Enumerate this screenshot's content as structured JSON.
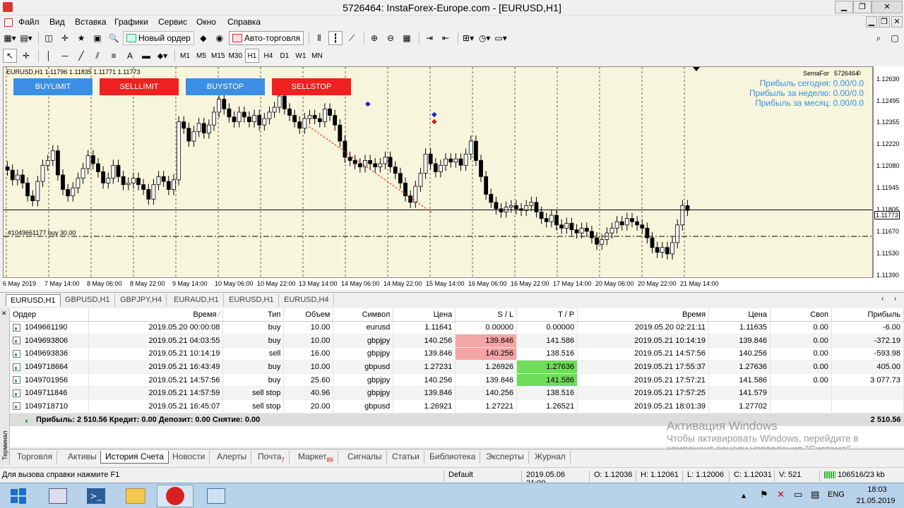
{
  "window": {
    "title": "5726464: InstaForex-Europe.com - [EURUSD,H1]",
    "min": "▁",
    "max": "❐",
    "close": "✕"
  },
  "menu": [
    "Файл",
    "Вид",
    "Вставка",
    "Графики",
    "Сервис",
    "Окно",
    "Справка"
  ],
  "toolbar": {
    "new_order": "Новый ордер",
    "autotrade": "Авто-торговля"
  },
  "timeframes": [
    "M1",
    "M5",
    "M15",
    "M30",
    "H1",
    "H4",
    "D1",
    "W1",
    "MN"
  ],
  "selected_timeframe": "H1",
  "chart": {
    "info": "EURUSD,H1  1.11796 1.11835 1.11771 1.11773",
    "buttons": {
      "buylimit": "BUYLIMIT",
      "selllimit": "SELLLIMIT",
      "buystop": "BUYSTOP",
      "sellstop": "SELLSTOP"
    },
    "indicator": "SemaFor",
    "account": "5726464",
    "profit_today": "Прибыль сегодня: 0.00/0.0",
    "profit_week": "Прибыль за неделю: 0.00/0.0",
    "profit_month": "Прибыль за месяц: 0.00/0.0",
    "order_line_label": "#1049661177 buy 30.00",
    "current_price": "1.11773",
    "price_levels": [
      "1.12630",
      "1.12495",
      "1.12355",
      "1.12220",
      "1.12080",
      "1.11945",
      "1.11805",
      "1.11670",
      "1.11530",
      "1.11390"
    ],
    "time_labels": [
      "6 May 2019",
      "7 May 14:00",
      "8 May 06:00",
      "8 May 22:00",
      "9 May 14:00",
      "10 May 06:00",
      "10 May 22:00",
      "13 May 14:00",
      "14 May 06:00",
      "14 May 22:00",
      "15 May 14:00",
      "16 May 06:00",
      "16 May 22:00",
      "17 May 14:00",
      "20 May 06:00",
      "20 May 22:00",
      "21 May 14:00"
    ],
    "close_series": [
      1.1202,
      1.1196,
      1.1199,
      1.1194,
      1.1186,
      1.1183,
      1.1195,
      1.1205,
      1.1208,
      1.1214,
      1.1199,
      1.119,
      1.1186,
      1.1191,
      1.1197,
      1.1203,
      1.1211,
      1.1206,
      1.1201,
      1.1194,
      1.1197,
      1.1205,
      1.1198,
      1.1193,
      1.1194,
      1.1197,
      1.1193,
      1.119,
      1.1184,
      1.1193,
      1.1198,
      1.1195,
      1.119,
      1.1196,
      1.1232,
      1.1228,
      1.122,
      1.1226,
      1.1231,
      1.1225,
      1.123,
      1.1238,
      1.1246,
      1.124,
      1.1235,
      1.1232,
      1.1238,
      1.1235,
      1.1232,
      1.1236,
      1.123,
      1.1234,
      1.1238,
      1.1241,
      1.1248,
      1.124,
      1.1236,
      1.1232,
      1.1228,
      1.1234,
      1.1236,
      1.1234,
      1.1232,
      1.124,
      1.1236,
      1.123,
      1.122,
      1.121,
      1.1208,
      1.1206,
      1.1204,
      1.1208,
      1.1206,
      1.1204,
      1.1206,
      1.121,
      1.1204,
      1.12,
      1.1194,
      1.1186,
      1.1182,
      1.1192,
      1.12,
      1.1212,
      1.1206,
      1.1201,
      1.1205,
      1.1209,
      1.1207,
      1.1209,
      1.1205,
      1.1212,
      1.122,
      1.1208,
      1.1198,
      1.1187,
      1.1182,
      1.1178,
      1.1176,
      1.1179,
      1.118,
      1.1178,
      1.1177,
      1.118,
      1.1182,
      1.1176,
      1.1172,
      1.117,
      1.1174,
      1.1168,
      1.1166,
      1.1169,
      1.1165,
      1.1163,
      1.1166,
      1.1164,
      1.116,
      1.1156,
      1.1159,
      1.1163,
      1.1166,
      1.117,
      1.1168,
      1.1172,
      1.117,
      1.1168,
      1.1166,
      1.116,
      1.1154,
      1.1151,
      1.1154,
      1.115,
      1.1157,
      1.1168,
      1.118,
      1.1177
    ]
  },
  "chart_tabs": [
    "EURUSD,H1",
    "GBPUSD,H1",
    "GBPJPY,H4",
    "EURAUD,H1",
    "EURUSD,H1",
    "EURUSD,H4"
  ],
  "terminal": {
    "side_label": "Терминал",
    "headers": [
      "Ордер",
      "Время",
      "Тип",
      "Объем",
      "Символ",
      "Цена",
      "S / L",
      "T / P",
      "Время",
      "Цена",
      "Своп",
      "Прибыль"
    ],
    "rows": [
      [
        "1049661190",
        "2019.05.20 00:00:08",
        "buy",
        "10.00",
        "eurusd",
        "1.11641",
        "0.00000",
        "0.00000",
        "2019.05.20 02:21:11",
        "1.11635",
        "0.00",
        "-6.00"
      ],
      [
        "1049693806",
        "2019.05.21 04:03:55",
        "buy",
        "10.00",
        "gbpjpy",
        "140.256",
        "139.846",
        "141.586",
        "2019.05.21 10:14:19",
        "139.846",
        "0.00",
        "-372.19"
      ],
      [
        "1049693836",
        "2019.05.21 10:14:19",
        "sell",
        "16.00",
        "gbpjpy",
        "139.846",
        "140.256",
        "138.516",
        "2019.05.21 14:57:56",
        "140.256",
        "0.00",
        "-593.98"
      ],
      [
        "1049718664",
        "2019.05.21 16:43:49",
        "buy",
        "10.00",
        "gbpusd",
        "1.27231",
        "1.26926",
        "1.27636",
        "2019.05.21 17:55:37",
        "1.27636",
        "0.00",
        "405.00"
      ],
      [
        "1049701956",
        "2019.05.21 14:57:56",
        "buy",
        "25.60",
        "gbpjpy",
        "140.256",
        "139.846",
        "141.586",
        "2019.05.21 17:57:21",
        "141.586",
        "0.00",
        "3 077.73"
      ],
      [
        "1049711846",
        "2019.05.21 14:57:59",
        "sell stop",
        "40.96",
        "gbpjpy",
        "139.846",
        "140.256",
        "138.516",
        "2019.05.21 17:57:25",
        "141.579",
        "",
        ""
      ],
      [
        "1049718710",
        "2019.05.21 16:45:07",
        "sell stop",
        "20.00",
        "gbpusd",
        "1.26921",
        "1.27221",
        "1.26521",
        "2019.05.21 18:01:39",
        "1.27702",
        "",
        ""
      ]
    ],
    "summary": "Прибыль: 2 510.56  Кредит: 0.00  Депозит: 0.00  Снятие: 0.00",
    "summary_total": "2 510.56",
    "colors": {
      "sl_hit": "#f4a6a6",
      "tp_hit": "#6fdc5a"
    }
  },
  "watermark": [
    "Активация Windows",
    "Чтобы активировать Windows, перейдите в",
    "компонент панели управления \"Система\"."
  ],
  "bottom_tabs": [
    {
      "label": "Торговля"
    },
    {
      "label": "Активы"
    },
    {
      "label": "История Счета"
    },
    {
      "label": "Новости"
    },
    {
      "label": "Алерты"
    },
    {
      "label": "Почта",
      "badge": "7"
    },
    {
      "label": "Маркет",
      "badge": "89"
    },
    {
      "label": "Сигналы"
    },
    {
      "label": "Статьи"
    },
    {
      "label": "Библиотека"
    },
    {
      "label": "Эксперты"
    },
    {
      "label": "Журнал"
    }
  ],
  "status": {
    "help": "Для вызова справки нажмите F1",
    "profile": "Default",
    "datetime": "2019.05.06 21:00",
    "open": "O: 1.12036",
    "high": "H: 1.12061",
    "low": "L: 1.12006",
    "close": "C: 1.12031",
    "volume": "V: 521",
    "traffic": "106516/23 kb"
  },
  "taskbar": {
    "lang": "ENG",
    "time": "18:03",
    "date": "21.05.2019"
  }
}
